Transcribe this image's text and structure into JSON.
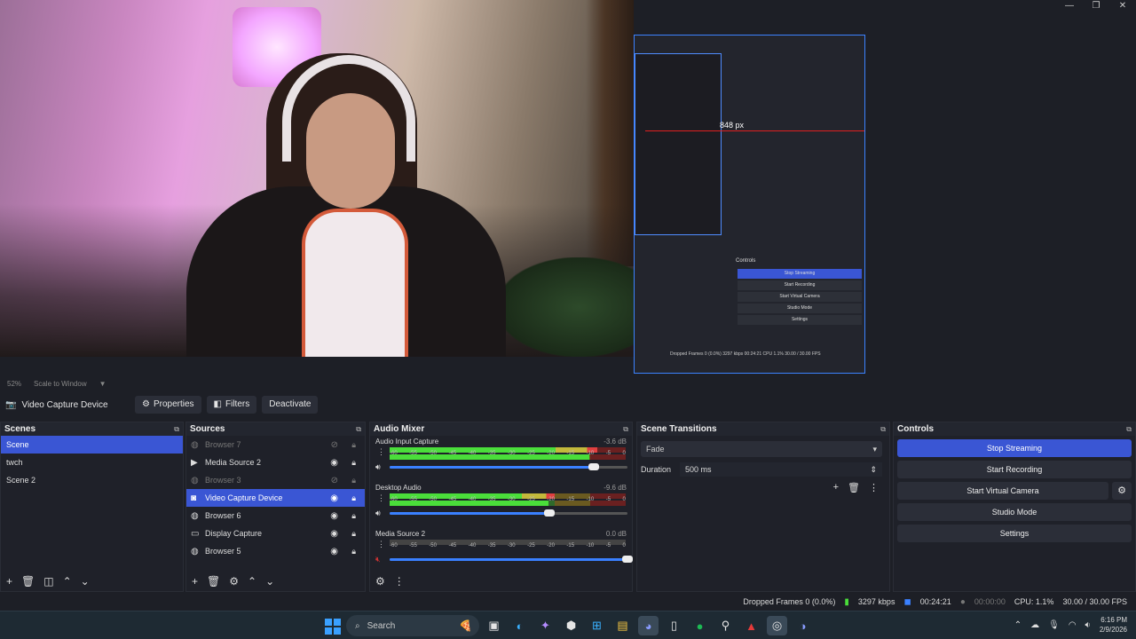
{
  "window_controls": {
    "minimize": "—",
    "restore": "❐",
    "close": "✕"
  },
  "preview": {
    "zoom": "52%",
    "scale_mode": "Scale to Window",
    "nested_measure": "848 px",
    "nested_controls_title": "Controls",
    "nested_buttons": [
      "Stop Streaming",
      "Start Recording",
      "Start Virtual Camera",
      "Studio Mode",
      "Settings"
    ],
    "nested_status": "Dropped Frames 0 (0.0%)   3297 kbps   00:24:21   CPU 1.1%   30.00 / 30.00 FPS"
  },
  "toolbar": {
    "current_source": "Video Capture Device",
    "properties": "Properties",
    "filters": "Filters",
    "deactivate": "Deactivate"
  },
  "scenes": {
    "title": "Scenes",
    "items": [
      "Scene",
      "twch",
      "Scene 2"
    ],
    "selected_index": 0
  },
  "sources": {
    "title": "Sources",
    "items": [
      {
        "name": "Browser 7",
        "icon": "browser-icon",
        "visible": false
      },
      {
        "name": "Media Source 2",
        "icon": "play-icon",
        "visible": true
      },
      {
        "name": "Browser 3",
        "icon": "browser-icon",
        "visible": false
      },
      {
        "name": "Video Capture Device",
        "icon": "camera-icon",
        "visible": true,
        "selected": true
      },
      {
        "name": "Browser 6",
        "icon": "browser-icon",
        "visible": true
      },
      {
        "name": "Display Capture",
        "icon": "monitor-icon",
        "visible": true
      },
      {
        "name": "Browser 5",
        "icon": "browser-icon",
        "visible": true
      }
    ]
  },
  "mixer": {
    "title": "Audio Mixer",
    "scale": [
      "-60",
      "-55",
      "-50",
      "-45",
      "-40",
      "-35",
      "-30",
      "-25",
      "-20",
      "-15",
      "-10",
      "-5",
      "0"
    ],
    "channels": [
      {
        "name": "Audio Input Capture",
        "db": "-3.6 dB",
        "level": 0.88,
        "volume": 0.86,
        "muted": false
      },
      {
        "name": "Desktop Audio",
        "db": "-9.6 dB",
        "level": 0.7,
        "volume": 0.67,
        "muted": false
      },
      {
        "name": "Media Source 2",
        "db": "0.0 dB",
        "level": 0.0,
        "volume": 1.0,
        "muted": true
      }
    ]
  },
  "transitions": {
    "title": "Scene Transitions",
    "selected": "Fade",
    "duration_label": "Duration",
    "duration_value": "500 ms"
  },
  "controls": {
    "title": "Controls",
    "stop_streaming": "Stop Streaming",
    "start_recording": "Start Recording",
    "start_virtual_camera": "Start Virtual Camera",
    "studio_mode": "Studio Mode",
    "settings": "Settings"
  },
  "status": {
    "dropped_frames": "Dropped Frames 0 (0.0%)",
    "bitrate": "3297 kbps",
    "stream_time": "00:24:21",
    "record_time": "00:00:00",
    "cpu": "CPU: 1.1%",
    "fps": "30.00 / 30.00 FPS"
  },
  "taskbar": {
    "search_label": "Search",
    "time": "6:16 PM",
    "date": "2/9/2026"
  },
  "colors": {
    "accent": "#3a56d4",
    "meter_green": "#4ade3a",
    "meter_red": "#e04040"
  }
}
